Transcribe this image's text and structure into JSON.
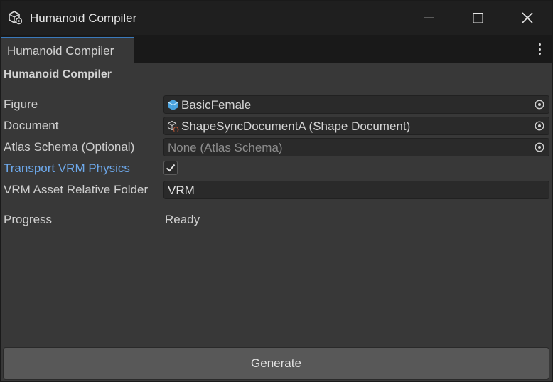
{
  "window": {
    "title": "Humanoid Compiler",
    "controls": [
      "minimize",
      "maximize",
      "close"
    ]
  },
  "tab": {
    "label": "Humanoid Compiler",
    "menu_icon": "more-vertical-icon"
  },
  "section": {
    "title": "Humanoid Compiler"
  },
  "fields": {
    "figure": {
      "label": "Figure",
      "value": "BasicFemale",
      "icon": "prefab-icon"
    },
    "document": {
      "label": "Document",
      "value": "ShapeSyncDocumentA (Shape Document)",
      "icon": "script-object-icon"
    },
    "atlas_schema": {
      "label": "Atlas Schema (Optional)",
      "value": "None (Atlas Schema)"
    },
    "transport_vrm_physics": {
      "label": "Transport VRM Physics",
      "checked": true
    },
    "vrm_folder": {
      "label": "VRM Asset Relative Folder",
      "value": "VRM"
    },
    "progress": {
      "label": "Progress",
      "value": "Ready"
    }
  },
  "actions": {
    "generate_label": "Generate"
  },
  "colors": {
    "accent": "#3a79bb",
    "modified_label": "#6da8ea",
    "prefab_icon": "#4aa3df"
  }
}
